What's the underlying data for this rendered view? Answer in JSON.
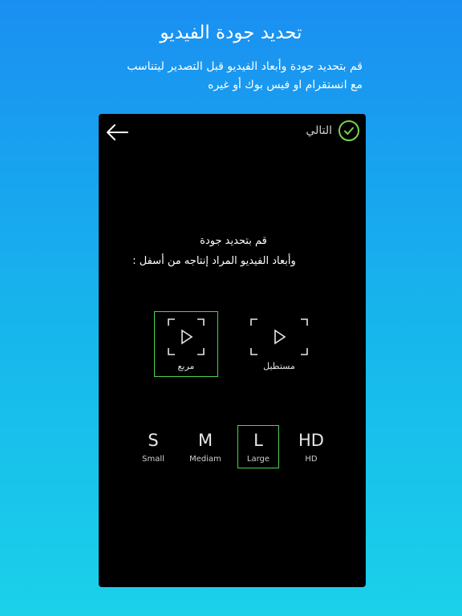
{
  "promo": {
    "title": "تحديد جودة الفيديو",
    "subtitle_line1": "قم بتحديد جودة وأبعاد الفيديو قبل التصدير ليتناسب",
    "subtitle_line2": "مع انستقرام او فيس بوك أو غيره"
  },
  "toolbar": {
    "back_icon": "arrow-left-icon",
    "next_label": "التالي",
    "next_icon": "check-circle-icon",
    "accent": "#76d44a"
  },
  "instructions": {
    "line1": "قم بتحديد جودة",
    "line2": "وأبعاد الفيديو المراد إنتاجه من أسفل :"
  },
  "aspect_ratios": {
    "items": [
      {
        "label": "مربع",
        "icon": "square-frame-play-icon",
        "selected": true
      },
      {
        "label": "مستطيل",
        "icon": "rectangle-frame-play-icon",
        "selected": false
      }
    ]
  },
  "quality": {
    "items": [
      {
        "code": "S",
        "name": "Small",
        "selected": false
      },
      {
        "code": "M",
        "name": "Mediam",
        "selected": false
      },
      {
        "code": "L",
        "name": "Large",
        "selected": true
      },
      {
        "code": "HD",
        "name": "HD",
        "selected": false
      }
    ]
  },
  "colors": {
    "selection": "#4fd24f",
    "background_top": "#1a8ff2",
    "background_bottom": "#1bd1ea"
  }
}
